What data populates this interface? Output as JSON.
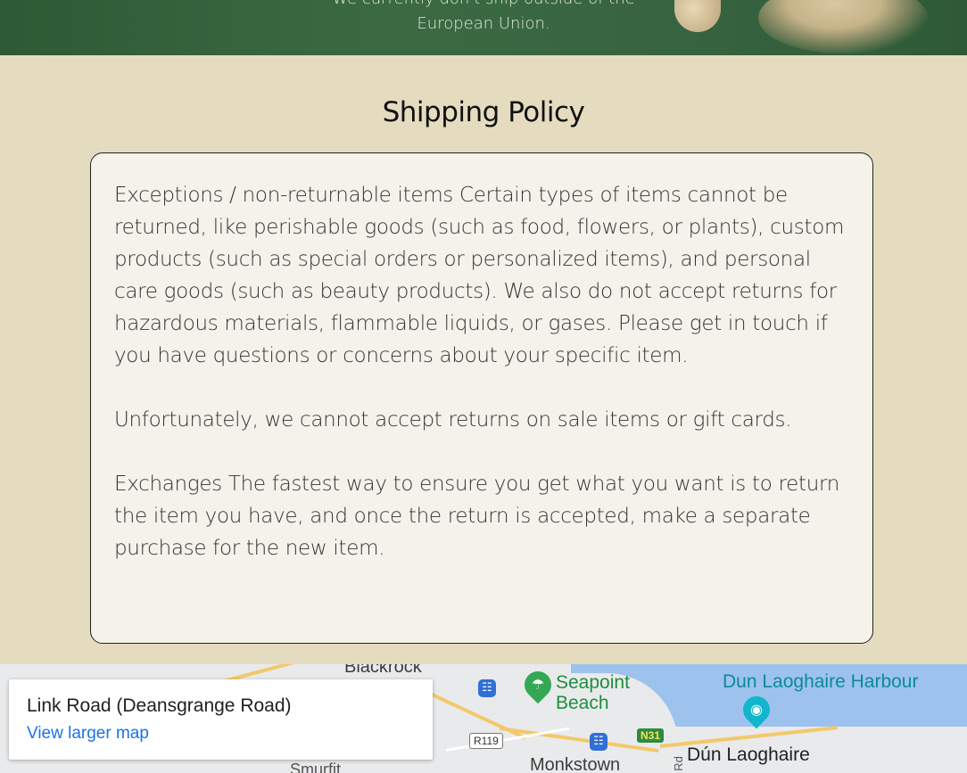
{
  "hero": {
    "line1": "We currently don't ship outside of the",
    "line2": "European Union."
  },
  "policy": {
    "title": "Shipping Policy",
    "paragraphs": [
      "Exceptions / non-returnable items Certain types of items cannot be returned, like perishable goods (such as food, flowers, or plants), custom products (such as special orders or personalized items), and personal care goods (such as beauty products). We also do not accept returns for hazardous materials, flammable liquids, or gases. Please get in touch if you have questions or concerns about your specific item.",
      "Unfortunately, we cannot accept returns on sale items or gift cards.",
      "Exchanges The fastest way to ensure you get what you want is to return the item you have, and once the return is accepted, make a separate purchase for the new item."
    ]
  },
  "map": {
    "place_name": "Link Road (Deansgrange Road)",
    "view_larger": "View larger map",
    "labels": {
      "blackrock": "Blackrock",
      "seapoint": "Seapoint",
      "beach": "Beach",
      "harbour": "Dun Laoghaire Harbour",
      "dun_laoghaire": "Dún Laoghaire",
      "monkstown": "Monkstown",
      "smurfit": "Smurfit",
      "rd": "Rd",
      "r119": "R119",
      "n31": "N31"
    },
    "icons": {
      "seapoint_pin": "beach-icon",
      "harbour_pin": "camera-icon",
      "transit": "train-icon"
    },
    "colors": {
      "water": "#9ec2ee",
      "park_pin": "#34a853",
      "poi_pin": "#12b5cb",
      "link": "#1a73e8"
    }
  }
}
